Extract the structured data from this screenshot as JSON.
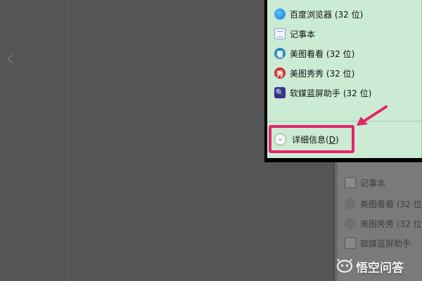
{
  "background": {
    "color": "#555555",
    "back_chevron": "‹"
  },
  "list_items": [
    {
      "label": "百度浏览器 (32 位)",
      "icon": "baidu-browser-icon"
    },
    {
      "label": "记事本",
      "icon": "notepad-icon"
    },
    {
      "label": "美图看看 (32 位)",
      "icon": "meitu-kankan-icon"
    },
    {
      "label": "美图秀秀 (32 位)",
      "icon": "meitu-xiuxiu-icon"
    },
    {
      "label": "软媒蓝屏助手 (32 位)",
      "icon": "ruanmei-bluescreen-icon"
    }
  ],
  "icon_glyphs": {
    "kankan": "看",
    "xiuxiu": "秀",
    "ruanmei": "🔍"
  },
  "details": {
    "label": "详细信息(",
    "accelerator": "D",
    "suffix": ")",
    "chevron": "⌄"
  },
  "bg_list_items": [
    {
      "label": "记事本"
    },
    {
      "label": "美图看看 (32 位"
    },
    {
      "label": "美图秀秀 (32 位"
    },
    {
      "label": "软媒蓝屏助手"
    }
  ],
  "watermark": {
    "text": "悟空问答"
  },
  "colors": {
    "list_bg": "#ccebd4",
    "highlight": "#e4236b",
    "arrow": "#e4236b"
  }
}
